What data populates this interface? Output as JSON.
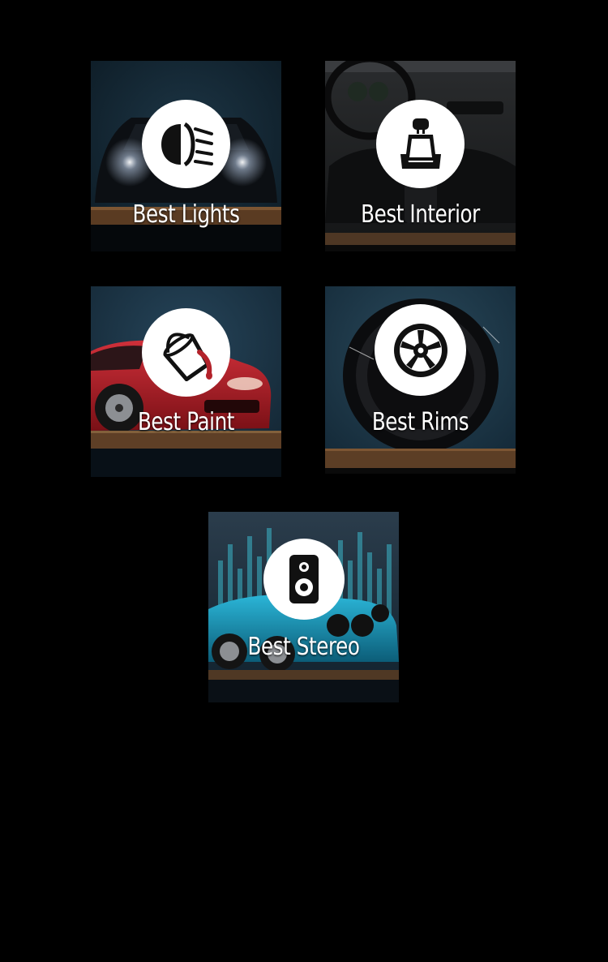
{
  "tiles": [
    {
      "id": "lights",
      "label": "Best Lights",
      "icon": "headlight-icon"
    },
    {
      "id": "interior",
      "label": "Best Interior",
      "icon": "car-seat-icon"
    },
    {
      "id": "paint",
      "label": "Best Paint",
      "icon": "paint-bucket-icon"
    },
    {
      "id": "rims",
      "label": "Best Rims",
      "icon": "rim-wheel-icon"
    },
    {
      "id": "stereo",
      "label": "Best Stereo",
      "icon": "speaker-icon"
    }
  ],
  "colors": {
    "background": "#000000",
    "label": "#ffffff",
    "icon_circle": "#ffffff",
    "icon": "#111111",
    "paint_red": "#b3222a",
    "stereo_teal": "#1a8fb0"
  }
}
